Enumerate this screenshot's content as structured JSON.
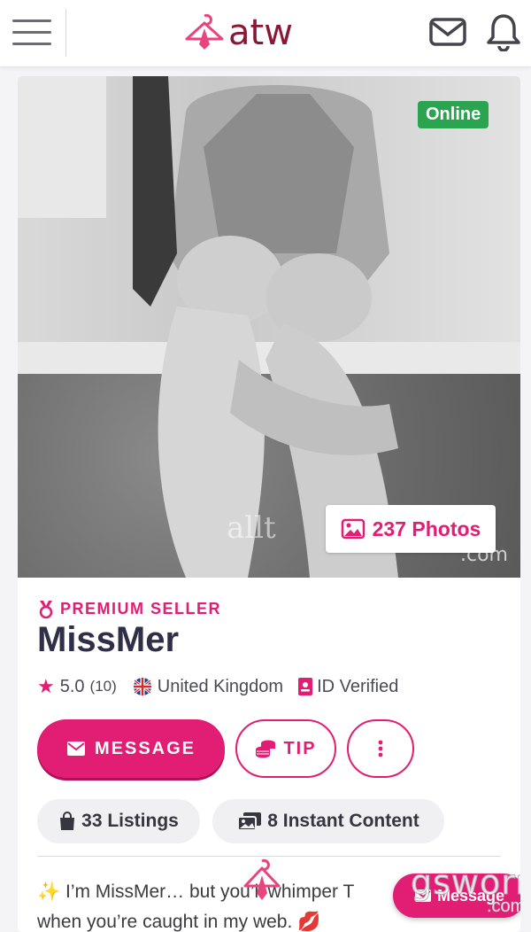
{
  "header": {
    "logo_text": "atw",
    "menu_icon": "hamburger-menu-icon",
    "mail_icon": "envelope-icon",
    "bell_icon": "bell-icon"
  },
  "profile": {
    "status_badge": "Online",
    "photos_badge": "237 Photos",
    "watermark": "allt",
    "watermark_suffix": ".com",
    "premium_label": "PREMIUM SELLER",
    "username": "MissMer",
    "rating": "5.0",
    "rating_count": "(10)",
    "location": "United Kingdom",
    "verified": "ID Verified"
  },
  "actions": {
    "message_label": "MESSAGE",
    "tip_label": "TIP"
  },
  "stats": {
    "listings": "33 Listings",
    "instant_content": "8 Instant Content"
  },
  "bio": {
    "line1_a": "✨ I’m MissMer… but you’ll whimper T",
    "line2": "when you’re caught in my web. 💋"
  },
  "floating": {
    "message_label": "Message",
    "brand_text": "gsworn",
    "brand_suffix": ".com"
  },
  "colors": {
    "accent": "#e11d74",
    "brand_dark": "#8a1736",
    "online": "#2aa44f"
  }
}
